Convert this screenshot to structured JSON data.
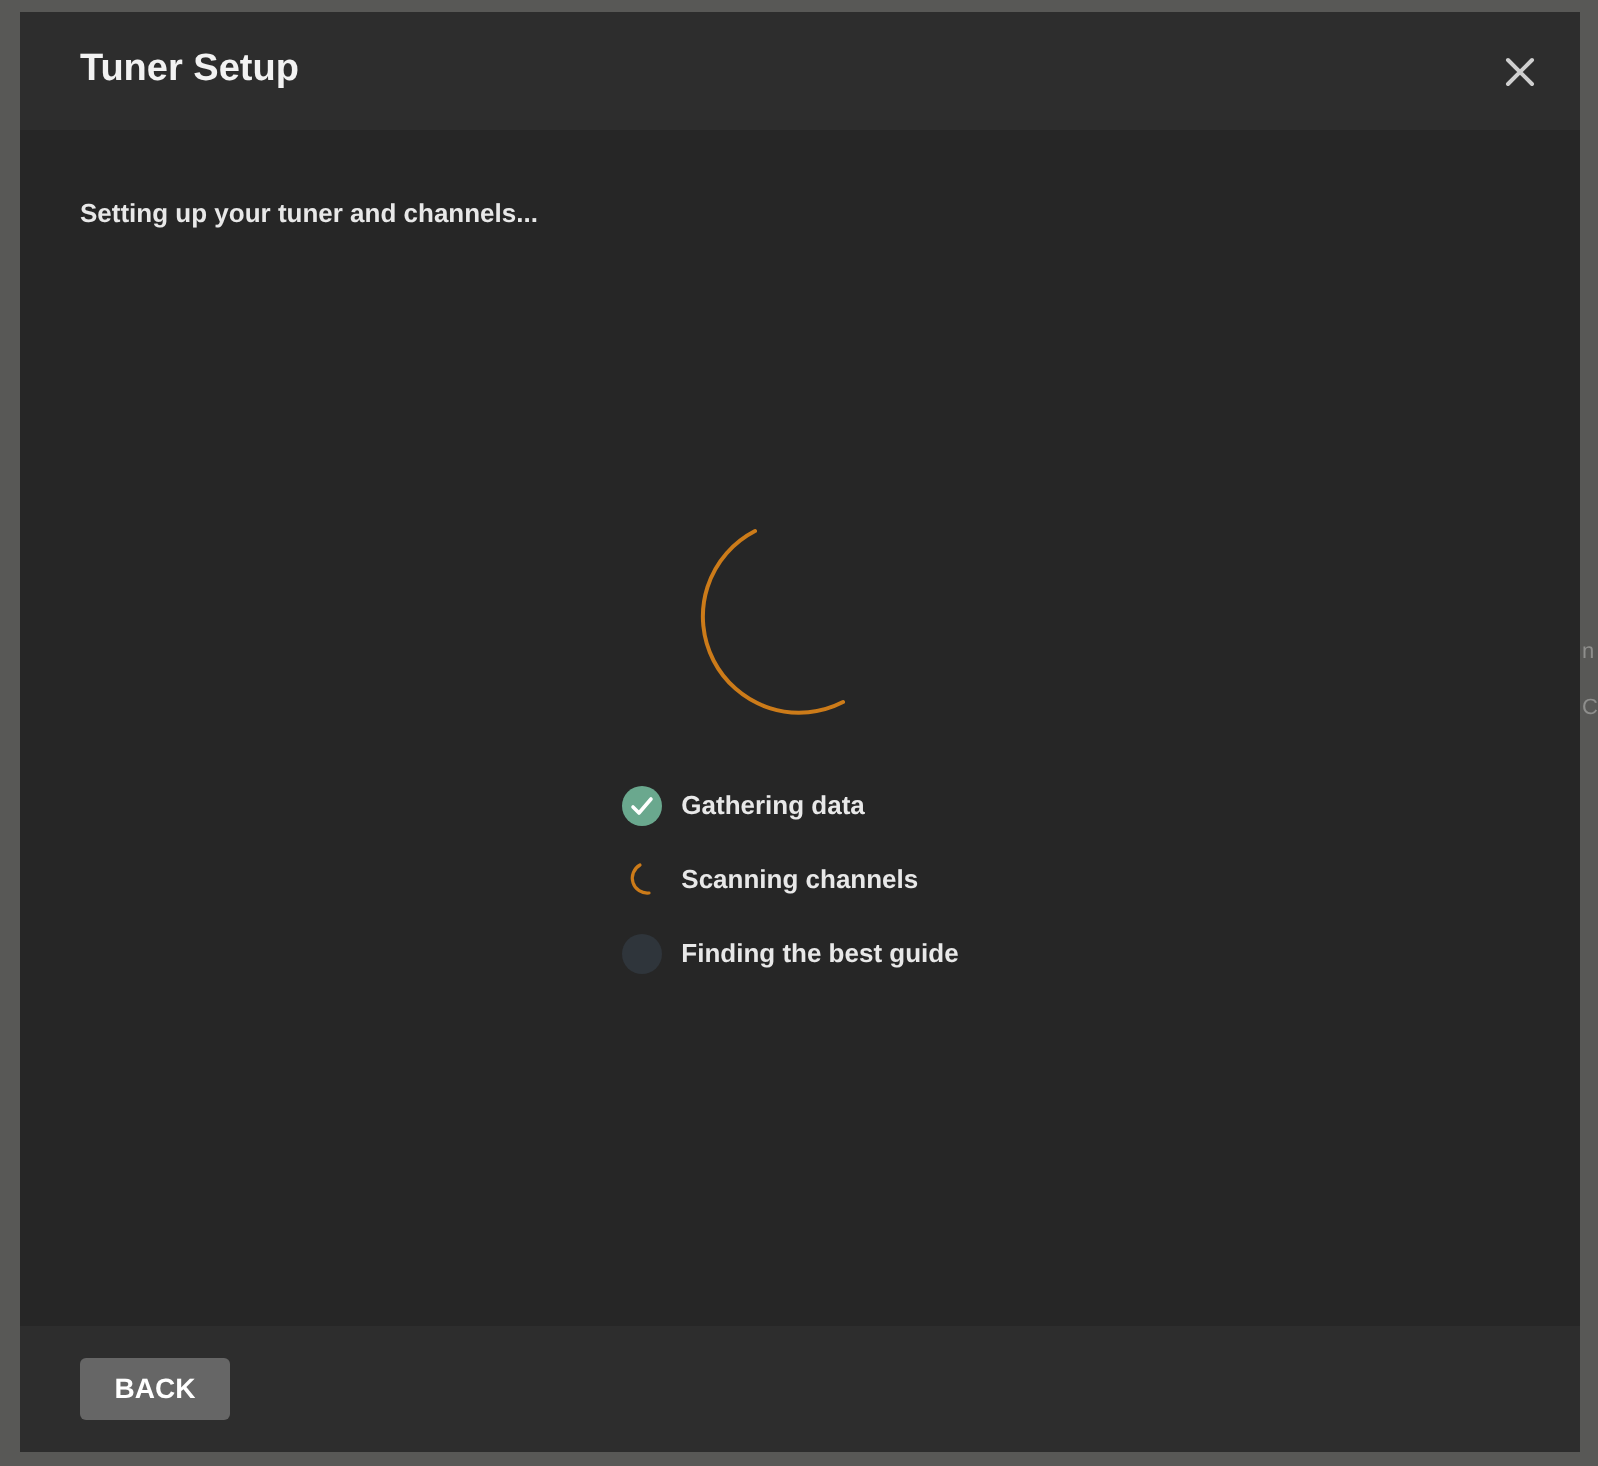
{
  "dialog": {
    "title": "Tuner Setup"
  },
  "message": "Setting up your tuner and channels...",
  "steps": [
    {
      "label": "Gathering data",
      "kind": "done"
    },
    {
      "label": "Scanning channels",
      "kind": "active"
    },
    {
      "label": "Finding the best guide",
      "kind": "pending"
    }
  ],
  "footer": {
    "back_button": "BACK"
  },
  "backdrop_texts": [
    "n",
    "C"
  ]
}
